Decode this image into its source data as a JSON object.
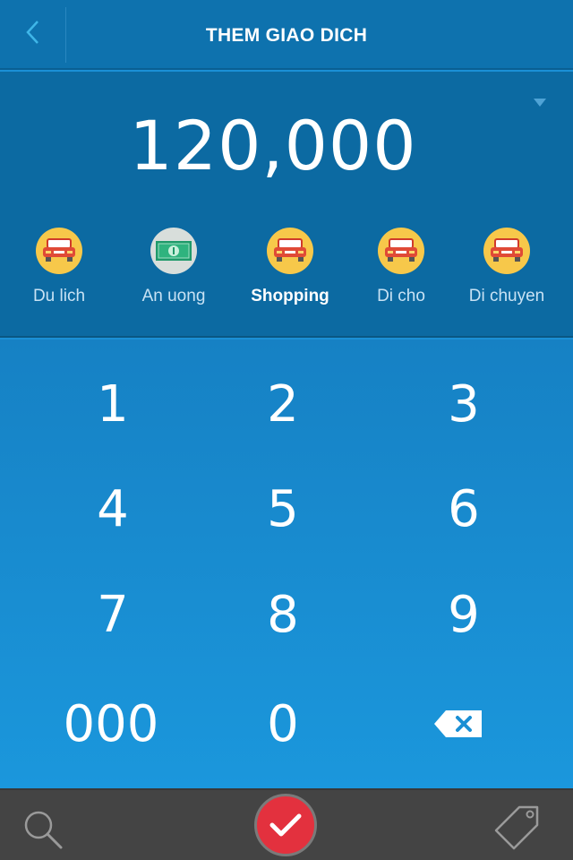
{
  "header": {
    "title": "THEM GIAO DICH",
    "back_icon": "chevron-left-icon"
  },
  "amount": {
    "value": "120,000"
  },
  "categories": [
    {
      "label": "Du lich",
      "icon": "car-icon",
      "active": false
    },
    {
      "label": "An uong",
      "icon": "money-icon",
      "active": false
    },
    {
      "label": "Shopping",
      "icon": "car-icon",
      "active": true
    },
    {
      "label": "Di cho",
      "icon": "car-icon",
      "active": false
    },
    {
      "label": "Di chuyen",
      "icon": "car-icon",
      "active": false
    }
  ],
  "keypad": {
    "k1": "1",
    "k2": "2",
    "k3": "3",
    "k4": "4",
    "k5": "5",
    "k6": "6",
    "k7": "7",
    "k8": "8",
    "k9": "9",
    "k000": "000",
    "k0": "0",
    "backspace_icon": "backspace-icon"
  },
  "bottom": {
    "search_icon": "search-icon",
    "confirm_icon": "check-icon",
    "tag_icon": "tag-icon"
  },
  "colors": {
    "header": "#0e72ae",
    "panel": "#0c6aa2",
    "keypad": "#1b90d6",
    "confirm": "#e3313e",
    "bottombar": "#444444"
  }
}
